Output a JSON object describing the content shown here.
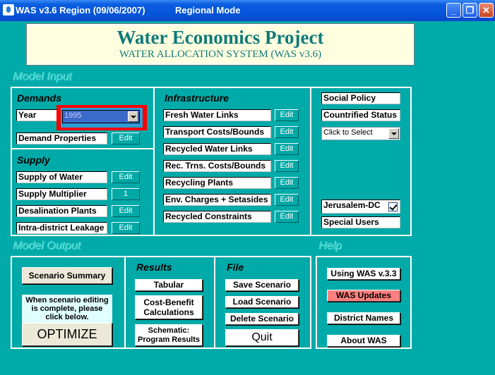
{
  "window": {
    "title": "WAS v3.6 Region (09/06/2007)",
    "mode": "Regional Mode",
    "minimize_label": "_",
    "maximize_label": "❐",
    "close_label": "✕"
  },
  "header": {
    "title": "Water Economics Project",
    "subtitle": "WATER ALLOCATION SYSTEM (WAS v3.6)"
  },
  "model_input": {
    "section_label": "Model Input",
    "demands": {
      "title": "Demands",
      "year_label": "Year",
      "year_value": "1995",
      "demand_properties": "Demand Properties",
      "edit_label": "Edit"
    },
    "supply": {
      "title": "Supply",
      "rows": [
        {
          "label": "Supply of Water",
          "action": "Edit"
        },
        {
          "label": "Supply Multiplier",
          "action": "1"
        },
        {
          "label": "Desalination Plants",
          "action": "Edit"
        },
        {
          "label": "Intra-district Leakage",
          "action": "Edit"
        }
      ]
    },
    "infrastructure": {
      "title": "Infrastructure",
      "rows": [
        {
          "label": "Fresh Water Links",
          "action": "Edit"
        },
        {
          "label": "Transport Costs/Bounds",
          "action": "Edit"
        },
        {
          "label": "Recycled Water Links",
          "action": "Edit"
        },
        {
          "label": "Rec. Trns. Costs/Bounds",
          "action": "Edit"
        },
        {
          "label": "Recycling Plants",
          "action": "Edit"
        },
        {
          "label": "Env. Charges + Setasides",
          "action": "Edit"
        },
        {
          "label": "Recycled Constraints",
          "action": "Edit"
        }
      ]
    },
    "policy": {
      "social_policy": "Social Policy",
      "countrified_status": "Countrified Status",
      "select_value": "Click to Select",
      "jerusalem": "Jerusalem-DC",
      "special_users": "Special Users"
    }
  },
  "model_output": {
    "section_label": "Model Output",
    "scenario_summary": "Scenario Summary",
    "note": "When scenario editing is complete, please click below.",
    "optimize": "OPTIMIZE",
    "results": {
      "title": "Results",
      "tabular": "Tabular",
      "cost_benefit": "Cost-Benefit Calculations",
      "schematic": "Schematic: Program Results"
    },
    "file": {
      "title": "File",
      "save": "Save Scenario",
      "load": "Load Scenario",
      "delete": "Delete Scenario",
      "quit": "Quit"
    }
  },
  "help": {
    "section_label": "Help",
    "using_was": "Using WAS v.3.3",
    "updates": "WAS Updates",
    "district_names": "District Names",
    "about": "About WAS"
  },
  "colors": {
    "background": "#00aaa8",
    "highlight": "#ff0000",
    "updates_button": "#ff8080"
  }
}
